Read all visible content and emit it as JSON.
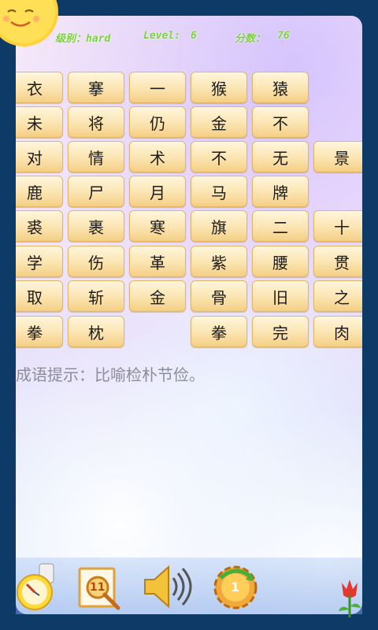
{
  "header": {
    "difficulty_label": "级别：hard",
    "level_label": "Level: ",
    "level_value": "6",
    "score_label": "分数：",
    "score_value": "76"
  },
  "board": {
    "rows": [
      [
        "衣",
        "搴",
        "一",
        "猴",
        "猿",
        ""
      ],
      [
        "未",
        "将",
        "仍",
        "金",
        "不",
        ""
      ],
      [
        "对",
        "情",
        "术",
        "不",
        "无",
        "景"
      ],
      [
        "鹿",
        "尸",
        "月",
        "马",
        "牌",
        ""
      ],
      [
        "裘",
        "裹",
        "寒",
        "旗",
        "二",
        "十"
      ],
      [
        "学",
        "伤",
        "革",
        "紫",
        "腰",
        "贯"
      ],
      [
        "取",
        "斩",
        "金",
        "骨",
        "旧",
        "之"
      ],
      [
        "拳",
        "枕",
        "",
        "拳",
        "完",
        "肉"
      ]
    ]
  },
  "hint": "成语提示：比喻检朴节俭。",
  "toolbar": {
    "clock_icon": "clock-icon",
    "search_badge": "11",
    "speaker_icon": "speaker-icon",
    "gear_badge": "1",
    "flower_icon": "tulip-icon"
  },
  "colors": {
    "frame": "#0e3a67",
    "header_text": "#7bd33a",
    "tile_top": "#fff6dc",
    "tile_bottom": "#f4cf84",
    "hint_text": "#8d8d9a"
  }
}
